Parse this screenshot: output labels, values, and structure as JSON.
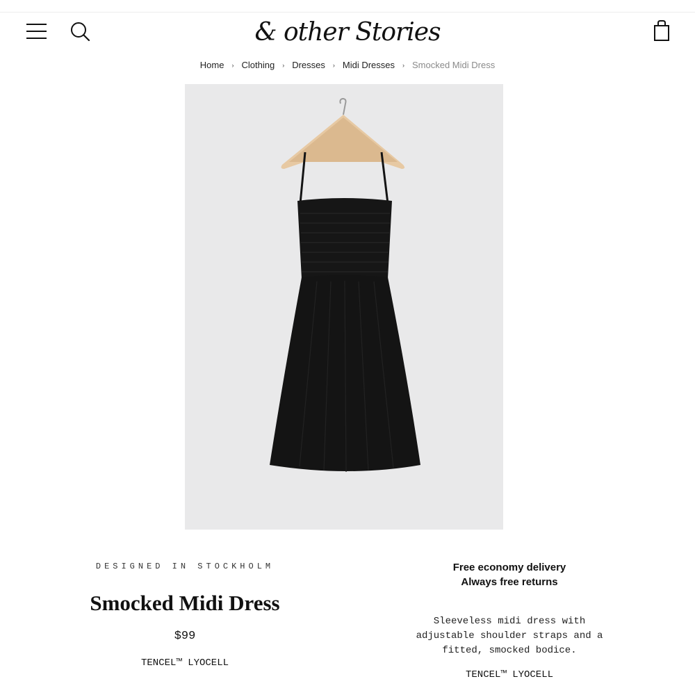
{
  "header": {
    "logo_text": "& other Stories",
    "menu_icon": "hamburger-menu-icon",
    "search_icon": "search-icon",
    "cart_icon": "shopping-bag-icon"
  },
  "breadcrumb": {
    "items": [
      "Home",
      "Clothing",
      "Dresses",
      "Midi Dresses",
      "Smocked Midi Dress"
    ],
    "separator": "›"
  },
  "product": {
    "designed_in": "DESIGNED IN STOCKHOLM",
    "name": "Smocked Midi Dress",
    "price": "$99",
    "material": "TENCEL™ LYOCELL",
    "delivery_line1": "Free economy delivery",
    "delivery_line2": "Always free returns",
    "description": "Sleeveless midi dress with adjustable shoulder straps and a fitted, smocked bodice.",
    "material_detail": "TENCEL™ LYOCELL",
    "image_colors": {
      "background": "#e9e9ea",
      "dress": "#141414",
      "hanger": "#e7c9a3"
    }
  }
}
